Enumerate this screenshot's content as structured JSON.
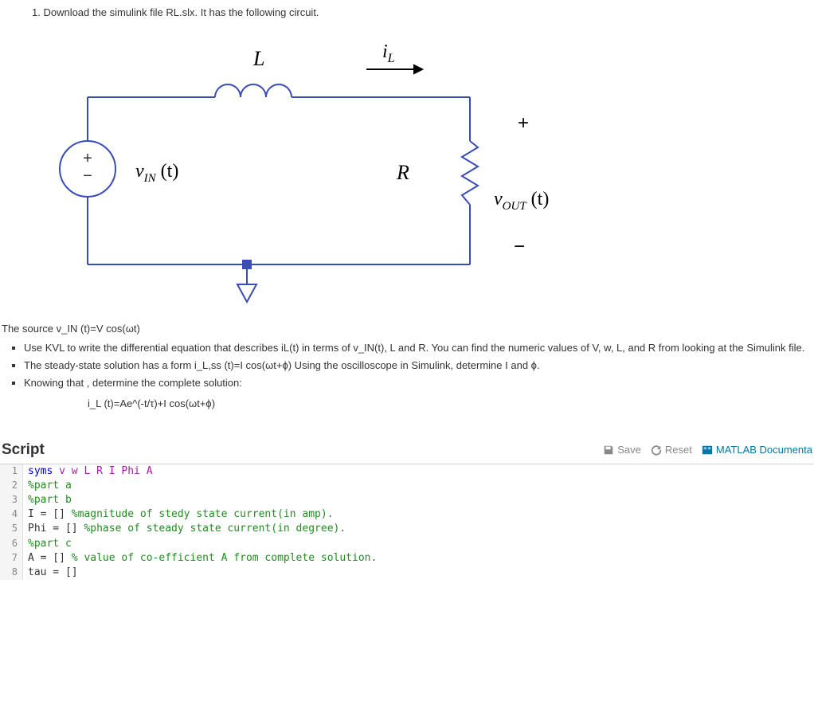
{
  "question": {
    "intro": "1. Download the simulink file RL.slx.  It has the following circuit.",
    "source_line": "The source v_IN (t)=V cos(ωt)",
    "bullet1": "Use KVL to write the differential equation that describes iL(t) in terms of v_IN(t), L  and R.  You can find the numeric values of V, w, L, and R from looking at the Simulink file.",
    "bullet2": "The steady-state solution has a form  i_L,ss (t)=I cos(ωt+ϕ) Using the oscilloscope in Simulink, determine I and ϕ.",
    "bullet3": "Knowing that , determine the complete solution:",
    "equation": "i_L (t)=Ae^(-t/τ)+I cos(ωt+ϕ)"
  },
  "circuit": {
    "L_label": "L",
    "iL_label": "i",
    "iL_sub": "L",
    "R_label": "R",
    "vin": "v",
    "vin_sub": "IN",
    "vin_arg": "(t)",
    "vout": "v",
    "vout_sub": "OUT",
    "vout_arg": "(t)",
    "plus": "+",
    "minus": "−"
  },
  "script": {
    "title": "Script",
    "save": "Save",
    "reset": "Reset",
    "doc": "MATLAB Documenta"
  },
  "code": {
    "l1_kw": "syms ",
    "l1_syms": "v w L R I Phi A",
    "l2": "%part a",
    "l3": "%part b",
    "l4a": "I = [] ",
    "l4b": "%magnitude of stedy state current(in amp).",
    "l5a": "Phi = [] ",
    "l5b": "%phase of steady state current(in degree).",
    "l6": "%part c",
    "l7a": "A = [] ",
    "l7b": "% value of co-efficient A from complete solution.",
    "l8": "tau = []"
  }
}
